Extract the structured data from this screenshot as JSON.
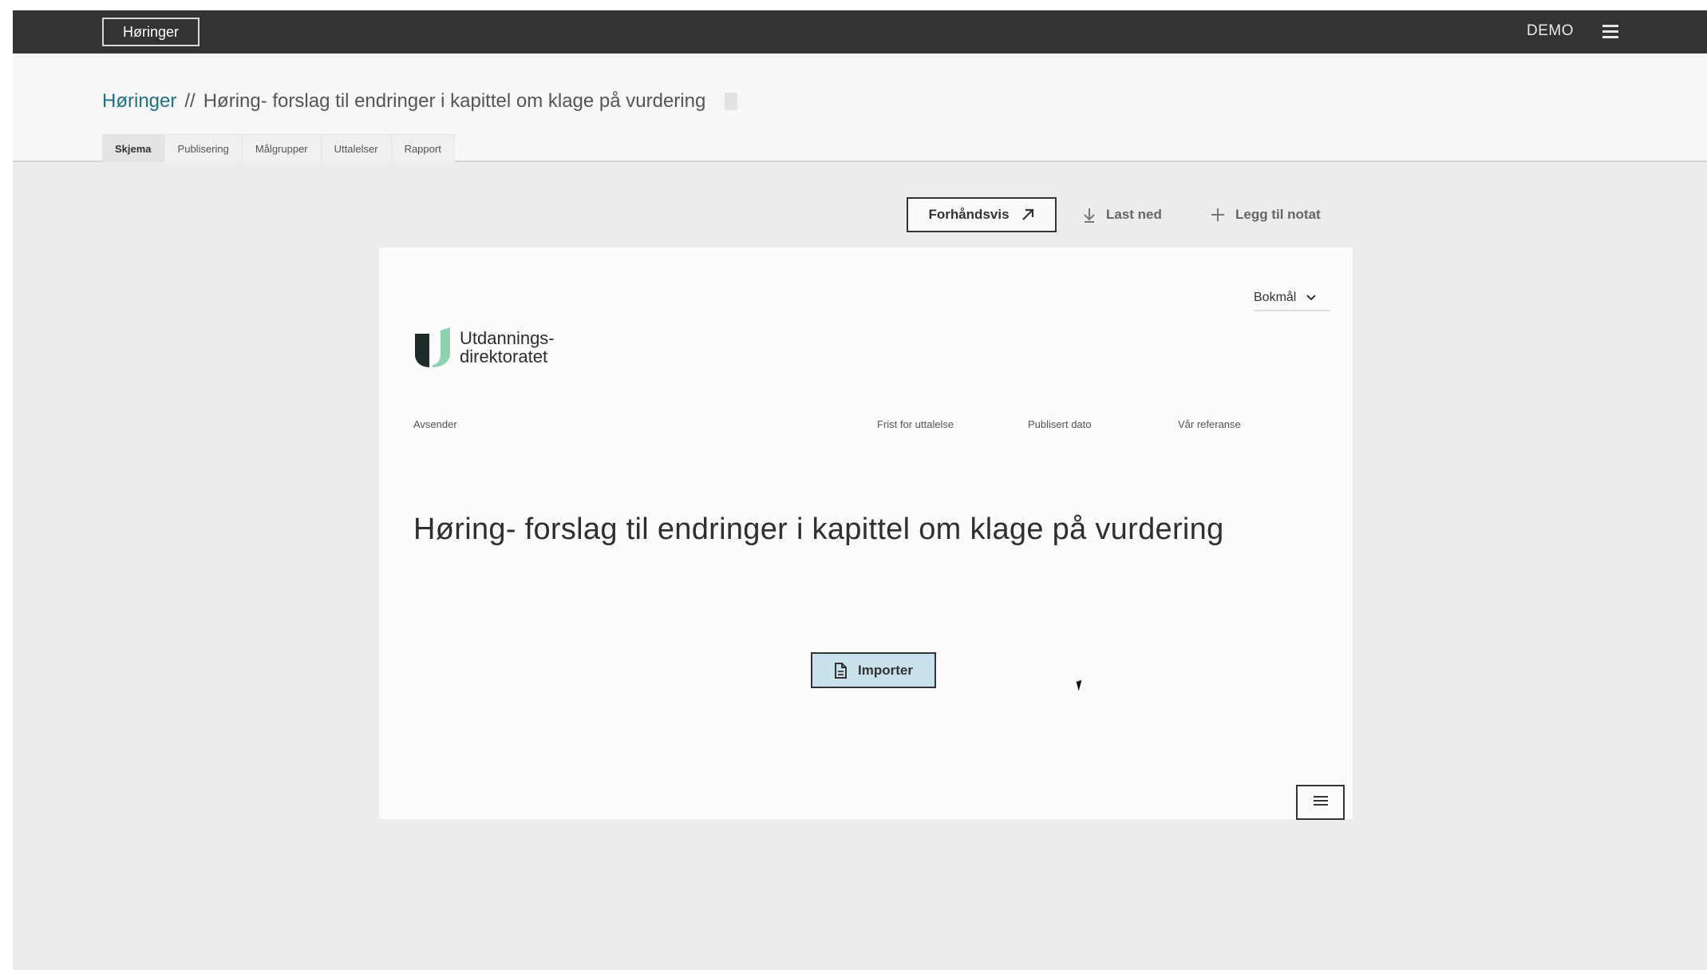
{
  "topbar": {
    "app_button_label": "Høringer",
    "env_label": "DEMO",
    "menu_icon": "hamburger-menu-icon"
  },
  "breadcrumb": {
    "link": "Høringer",
    "separator": "//",
    "current": "Høring- forslag til endringer i kapittel om klage på vurdering",
    "bookmark_icon": "bookmark-icon"
  },
  "tabs": [
    {
      "label": "Skjema",
      "active": true
    },
    {
      "label": "Publisering"
    },
    {
      "label": "Målgrupper"
    },
    {
      "label": "Uttalelser"
    },
    {
      "label": "Rapport"
    }
  ],
  "toolbar": {
    "preview_label": "Forhåndsvis",
    "preview_icon": "external-link-arrow-icon",
    "download_label": "Last ned",
    "download_icon": "download-arrow-icon",
    "add_note_label": "Legg til notat",
    "add_note_icon": "plus-icon"
  },
  "document": {
    "language": "Bokmål",
    "logo_line1": "Utdannings-",
    "logo_line2": "direktoratet",
    "meta": {
      "sender_label": "Avsender",
      "deadline_label": "Frist for uttalelse",
      "published_label": "Publisert dato",
      "reference_label": "Vår referanse"
    },
    "title": "Høring- forslag til endringer i kapittel om klage på vurdering",
    "import_label": "Importer",
    "import_icon": "document-icon",
    "menu_icon": "hamburger-menu-icon"
  },
  "colors": {
    "topbar": "#333333",
    "link": "#1f6f86",
    "import_button": "#c9e1ea",
    "logo_dark": "#1f2a2a",
    "logo_green": "#8fd0b0"
  }
}
